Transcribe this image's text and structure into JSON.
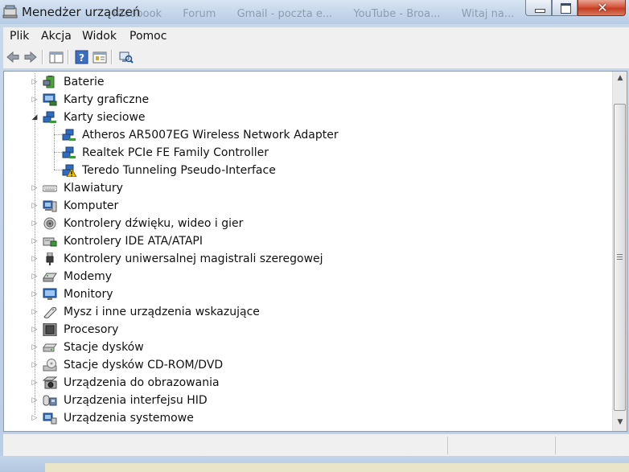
{
  "window": {
    "title": "Menedżer urządzeń"
  },
  "background_tabs": [
    "Facebook",
    "Forum",
    "Gmail - poczta e...",
    "YouTube - Broa...",
    "Witaj na..."
  ],
  "menu": [
    "Plik",
    "Akcja",
    "Widok",
    "Pomoc"
  ],
  "toolbar": [
    "back-icon",
    "forward-icon",
    "show-hide-console-tree-icon",
    "help-icon",
    "properties-icon",
    "scan-hardware-icon"
  ],
  "tree": [
    {
      "label": "Baterie",
      "icon": "battery-icon",
      "expanded": false,
      "level": 0
    },
    {
      "label": "Karty graficzne",
      "icon": "display-adapter-icon",
      "expanded": false,
      "level": 0
    },
    {
      "label": "Karty sieciowe",
      "icon": "network-adapter-icon",
      "expanded": true,
      "level": 0
    },
    {
      "label": "Atheros AR5007EG Wireless Network Adapter",
      "icon": "network-adapter-icon",
      "level": 1
    },
    {
      "label": "Realtek PCIe FE Family Controller",
      "icon": "network-adapter-icon",
      "level": 1
    },
    {
      "label": "Teredo Tunneling Pseudo-Interface",
      "icon": "network-adapter-warning-icon",
      "level": 1,
      "warning": true
    },
    {
      "label": "Klawiatury",
      "icon": "keyboard-icon",
      "expanded": false,
      "level": 0
    },
    {
      "label": "Komputer",
      "icon": "computer-icon",
      "expanded": false,
      "level": 0
    },
    {
      "label": "Kontrolery dźwięku, wideo i gier",
      "icon": "speaker-icon",
      "expanded": false,
      "level": 0
    },
    {
      "label": "Kontrolery IDE ATA/ATAPI",
      "icon": "ide-controller-icon",
      "expanded": false,
      "level": 0
    },
    {
      "label": "Kontrolery uniwersalnej magistrali szeregowej",
      "icon": "usb-plug-icon",
      "expanded": false,
      "level": 0
    },
    {
      "label": "Modemy",
      "icon": "modem-icon",
      "expanded": false,
      "level": 0
    },
    {
      "label": "Monitory",
      "icon": "monitor-icon",
      "expanded": false,
      "level": 0
    },
    {
      "label": "Mysz i inne urządzenia wskazujące",
      "icon": "mouse-icon",
      "expanded": false,
      "level": 0
    },
    {
      "label": "Procesory",
      "icon": "processor-icon",
      "expanded": false,
      "level": 0
    },
    {
      "label": "Stacje dysków",
      "icon": "disk-drive-icon",
      "expanded": false,
      "level": 0
    },
    {
      "label": "Stacje dysków CD-ROM/DVD",
      "icon": "cd-rom-icon",
      "expanded": false,
      "level": 0
    },
    {
      "label": "Urządzenia do obrazowania",
      "icon": "camera-icon",
      "expanded": false,
      "level": 0
    },
    {
      "label": "Urządzenia interfejsu HID",
      "icon": "hid-icon",
      "expanded": false,
      "level": 0
    },
    {
      "label": "Urządzenia systemowe",
      "icon": "system-devices-icon",
      "expanded": false,
      "level": 0
    }
  ],
  "colors": {
    "titlebar": "#c3d5ea",
    "close_button": "#c43d22",
    "menu_background": "#f0f0f0",
    "warning": "#f2c200"
  }
}
